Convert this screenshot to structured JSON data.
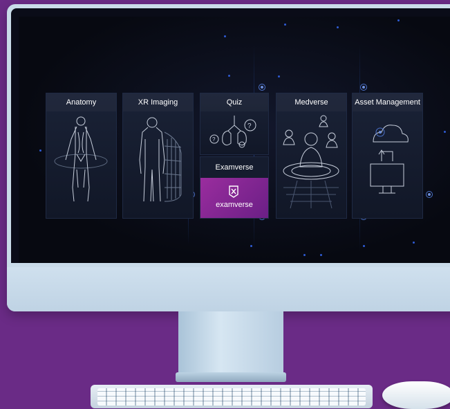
{
  "tiles": [
    {
      "label": "Anatomy"
    },
    {
      "label": "XR Imaging"
    },
    {
      "label": "Quiz"
    },
    {
      "label": "Medverse"
    },
    {
      "label": "Asset Management"
    }
  ],
  "examverse": {
    "title": "Examverse",
    "logo_text": "examverse"
  },
  "colors": {
    "background": "#6a2b86",
    "screen": "#070911",
    "accent": "#9a2d9e",
    "node": "#2f5bd3"
  }
}
